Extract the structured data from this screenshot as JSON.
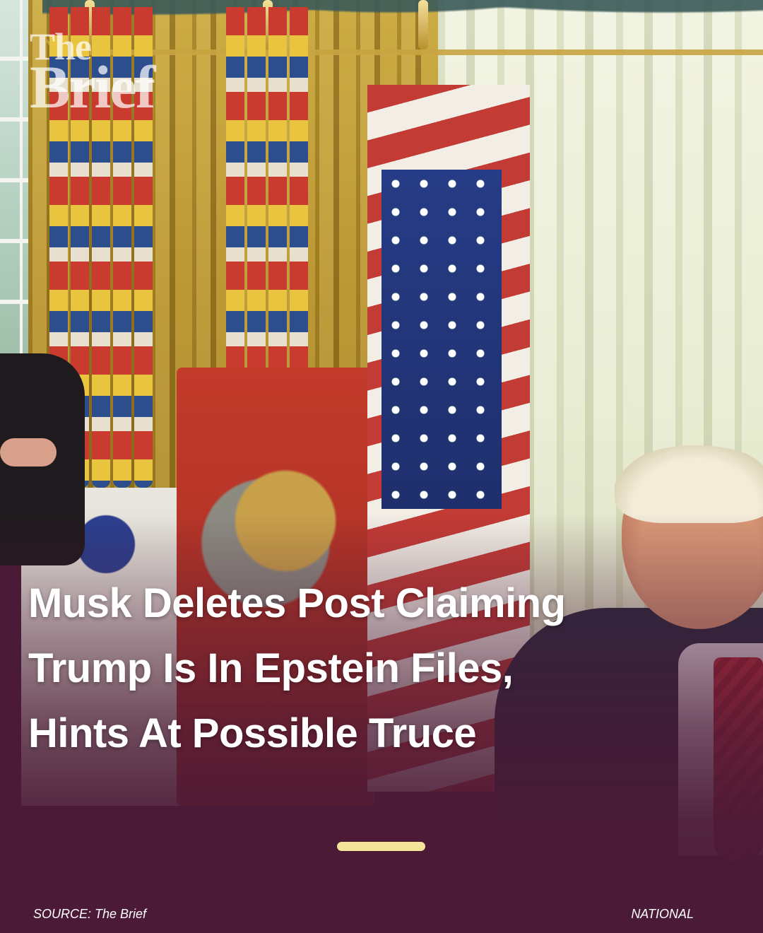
{
  "logo": {
    "line1": "The",
    "line2": "Brief"
  },
  "headline": {
    "line1": "Musk Deletes Post Claiming",
    "line2": "Trump Is In Epstein Files,",
    "line3": "Hints At Possible Truce"
  },
  "footer": {
    "source": "SOURCE: The Brief",
    "category": "NATIONAL"
  },
  "colors": {
    "overlay": "#4a1a36",
    "pager_indicator": "#f4e49a",
    "text": "#ffffff"
  }
}
